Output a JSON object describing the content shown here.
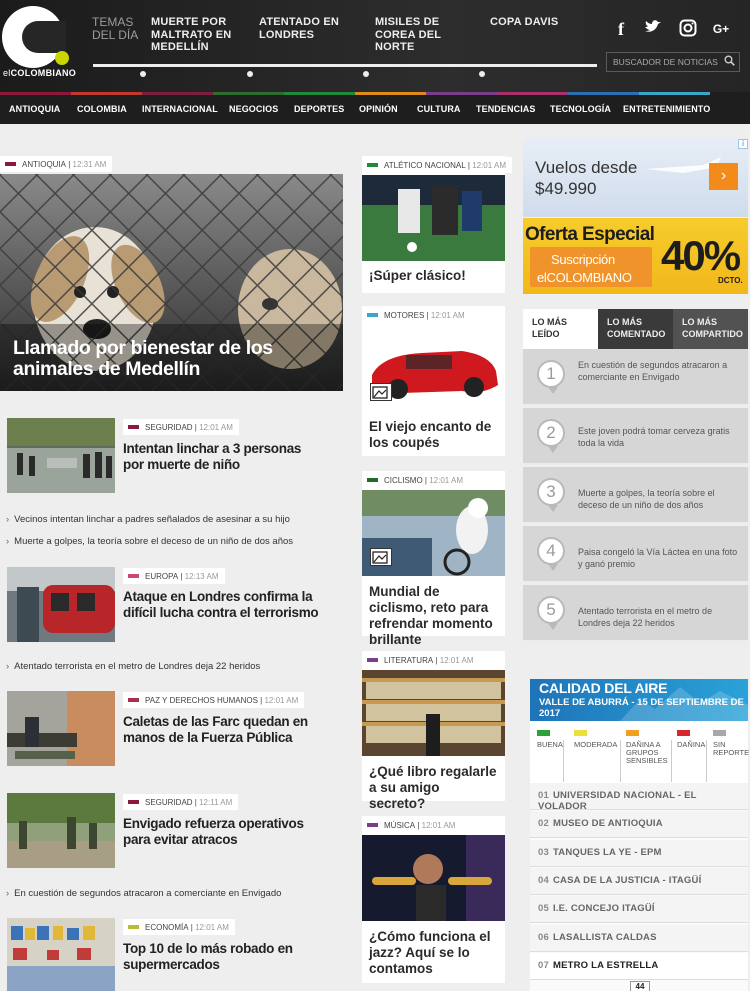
{
  "brand": {
    "name_prefix": "el",
    "name": "COLOMBIANO"
  },
  "header": {
    "temas_label": "TEMAS DEL DÍA",
    "topics": [
      "MUERTE POR MALTRATO EN MEDELLÍN",
      "ATENTADO EN LONDRES",
      "MISILES DE COREA DEL NORTE",
      "COPA DAVIS"
    ],
    "social": [
      "f",
      "t",
      "◎",
      "G+"
    ],
    "search_placeholder": "BUSCADOR DE NOTICIAS"
  },
  "nav": {
    "items": [
      "ANTIOQUIA",
      "COLOMBIA",
      "INTERNACIONAL",
      "NEGOCIOS",
      "DEPORTES",
      "OPINIÓN",
      "CULTURA",
      "TENDENCIAS",
      "TECNOLOGÍA",
      "ENTRETENIMIENTO"
    ],
    "stripe_colors": [
      "#8b1a3a",
      "#c0392b",
      "#7a1f3d",
      "#2e6b2e",
      "#1f8a3a",
      "#e08a1e",
      "#7a3d8a",
      "#a8306b",
      "#2c6fb3",
      "#3aa6c9"
    ]
  },
  "main": {
    "lead": {
      "section": "ANTIOQUIA",
      "time": "12:31 AM",
      "title": "Llamado por bienestar de los animales de Medellín",
      "color": "#8b1a3a"
    },
    "stories": [
      {
        "section": "SEGURIDAD",
        "time": "12:01 AM",
        "title": "Intentan linchar a 3 personas por muerte de niño",
        "color": "#8b1a3a",
        "related": [
          "Vecinos intentan linchar a padres señalados de asesinar a su hijo",
          "Muerte a golpes, la teoría sobre el deceso de un niño de dos años"
        ]
      },
      {
        "section": "EUROPA",
        "time": "12:13 AM",
        "title": "Ataque en Londres confirma la difícil lucha contra el terrorismo",
        "color": "#c94c6e",
        "related": [
          "Atentado terrorista en el metro de Londres deja 22 heridos"
        ]
      },
      {
        "section": "PAZ Y DERECHOS HUMANOS",
        "time": "12:01 AM",
        "title": "Caletas de las Farc quedan en manos de la Fuerza Pública",
        "color": "#a8304f",
        "related": []
      },
      {
        "section": "SEGURIDAD",
        "time": "12:11 AM",
        "title": "Envigado refuerza operativos para evitar atracos",
        "color": "#8b1a3a",
        "related": [
          "En cuestión de segundos atracaron a comerciante en Envigado"
        ]
      },
      {
        "section": "ECONOMÍA",
        "time": "12:01 AM",
        "title": "Top 10 de lo más robado en supermercados",
        "color": "#b9b93a",
        "related": []
      }
    ]
  },
  "middle": [
    {
      "section": "ATLÉTICO NACIONAL",
      "time": "12:01 AM",
      "title": "¡Súper clásico!",
      "color": "#1f8a3a"
    },
    {
      "section": "MOTORES",
      "time": "12:01 AM",
      "title": "El viejo encanto de los coupés",
      "color": "#3aa6c9"
    },
    {
      "section": "CICLISMO",
      "time": "12:01 AM",
      "title": "Mundial de ciclismo, reto para refrendar momento brillante",
      "color": "#1f6b2e"
    },
    {
      "section": "LITERATURA",
      "time": "12:01 AM",
      "title": "¿Qué libro regalarle a su amigo secreto?",
      "color": "#7a3d8a"
    },
    {
      "section": "MÚSICA",
      "time": "12:01 AM",
      "title": "¿Cómo funciona el jazz? Aquí se lo contamos",
      "color": "#7a3d8a"
    }
  ],
  "ads": {
    "flight": {
      "line1": "Vuelos desde",
      "line2": "$49.990"
    },
    "promo": {
      "title": "Oferta Especial",
      "line1": "Suscripción",
      "line2": "elCOLOMBIANO",
      "pct": "40%",
      "dcto": "DCTO."
    }
  },
  "popular": {
    "tabs": [
      "LO MÁS LEÍDO",
      "LO MÁS COMENTADO",
      "LO MÁS COMPARTIDO"
    ],
    "items": [
      {
        "n": "1",
        "text": "En cuestión de segundos atracaron a comerciante en Envigado"
      },
      {
        "n": "2",
        "text": "Este joven podrá tomar cerveza gratis toda la vida"
      },
      {
        "n": "3",
        "text": "Muerte a golpes, la teoría sobre el deceso de un niño de dos años"
      },
      {
        "n": "4",
        "text": "Paisa congeló la Vía Láctea en una foto y ganó premio"
      },
      {
        "n": "5",
        "text": "Atentado terrorista en el metro de Londres deja 22 heridos"
      }
    ]
  },
  "air": {
    "title": "CALIDAD DEL AIRE",
    "subtitle": "VALLE DE ABURRÁ - 15 DE SEPTIEMBRE DE 2017",
    "legend": [
      {
        "label": "BUENA",
        "color": "#2ea03a"
      },
      {
        "label": "MODERADA",
        "color": "#e8e13a"
      },
      {
        "label": "DAÑINA A GRUPOS SENSIBLES",
        "color": "#f0a021"
      },
      {
        "label": "DAÑINA",
        "color": "#d9262b"
      },
      {
        "label": "SIN REPORTE",
        "color": "#a8a8a8"
      }
    ],
    "stations": [
      {
        "n": "01",
        "name": "UNIVERSIDAD NACIONAL - EL VOLADOR"
      },
      {
        "n": "02",
        "name": "MUSEO DE ANTIOQUIA"
      },
      {
        "n": "03",
        "name": "TANQUES LA YE - EPM"
      },
      {
        "n": "04",
        "name": "CASA DE LA JUSTICIA - ITAGÜÍ"
      },
      {
        "n": "05",
        "name": "I.E. CONCEJO ITAGÜÍ"
      },
      {
        "n": "06",
        "name": "LASALLISTA CALDAS"
      },
      {
        "n": "07",
        "name": "METRO LA ESTRELLA"
      }
    ],
    "next_value": "44"
  }
}
